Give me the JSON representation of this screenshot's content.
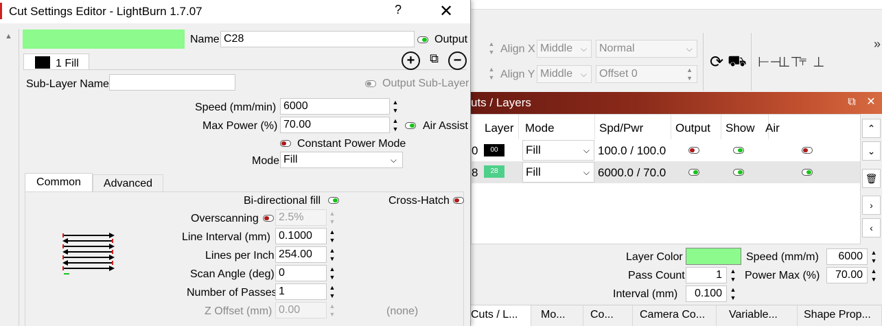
{
  "dialog": {
    "title": "Cut Settings Editor - LightBurn 1.7.07",
    "help_label": "?",
    "close_label": "✕",
    "layer_color": "#8cfa8c",
    "name_label": "Name",
    "name_value": "C28",
    "output_label": "Output",
    "sublayer_tab_label": "1 Fill",
    "sublayer_name_label": "Sub-Layer Name",
    "sublayer_name_value": "",
    "output_sublayer_label": "Output Sub-Layer",
    "speed_label": "Speed (mm/min)",
    "speed_value": "6000",
    "max_power_label": "Max Power (%)",
    "max_power_value": "70.00",
    "air_assist_label": "Air Assist",
    "constant_power_label": "Constant Power Mode",
    "mode_label": "Mode",
    "mode_value": "Fill",
    "tabs": [
      "Common",
      "Advanced"
    ],
    "bidirectional_label": "Bi-directional fill",
    "crosshatch_label": "Cross-Hatch",
    "overscanning_label": "Overscanning",
    "overscanning_value": "2.5%",
    "line_interval_label": "Line Interval (mm)",
    "line_interval_value": "0.1000",
    "lpi_label": "Lines per Inch",
    "lpi_value": "254.00",
    "scan_angle_label": "Scan Angle (deg)",
    "scan_angle_value": "0",
    "passes_label": "Number of Passes",
    "passes_value": "1",
    "z_offset_label": "Z Offset (mm)",
    "z_offset_value": "0.00",
    "z_offset_note": "(none)"
  },
  "toolbar": {
    "align_x_label": "Align X",
    "align_x_value": "Middle",
    "align_y_label": "Align Y",
    "align_y_value": "Middle",
    "normal_value": "Normal",
    "offset_value": "Offset 0"
  },
  "layers": {
    "title": "uts / Layers",
    "headers": [
      "Layer",
      "Mode",
      "Spd/Pwr",
      "Output",
      "Show",
      "Air"
    ],
    "rows": [
      {
        "num": "0",
        "swatch": "00",
        "swatch_color": "#000000",
        "mode": "Fill",
        "spdpwr": "100.0 / 100.0",
        "output": false,
        "show": true,
        "air": false
      },
      {
        "num": "8",
        "swatch": "28",
        "swatch_color": "#4fd08a",
        "mode": "Fill",
        "spdpwr": "6000.0 / 70.0",
        "output": true,
        "show": true,
        "air": true
      }
    ]
  },
  "props": {
    "layer_color_label": "Layer Color",
    "layer_color": "#8cfa8c",
    "pass_count_label": "Pass Count",
    "pass_count_value": "1",
    "interval_label": "Interval (mm)",
    "interval_value": "0.100",
    "speed_label": "Speed (mm/m)",
    "speed_value": "6000",
    "power_max_label": "Power Max (%)",
    "power_max_value": "70.00"
  },
  "bottom_tabs": [
    "Cuts / L...",
    "Mo...",
    "Co...",
    "Camera Co...",
    "Variable...",
    "Shape Prop..."
  ]
}
